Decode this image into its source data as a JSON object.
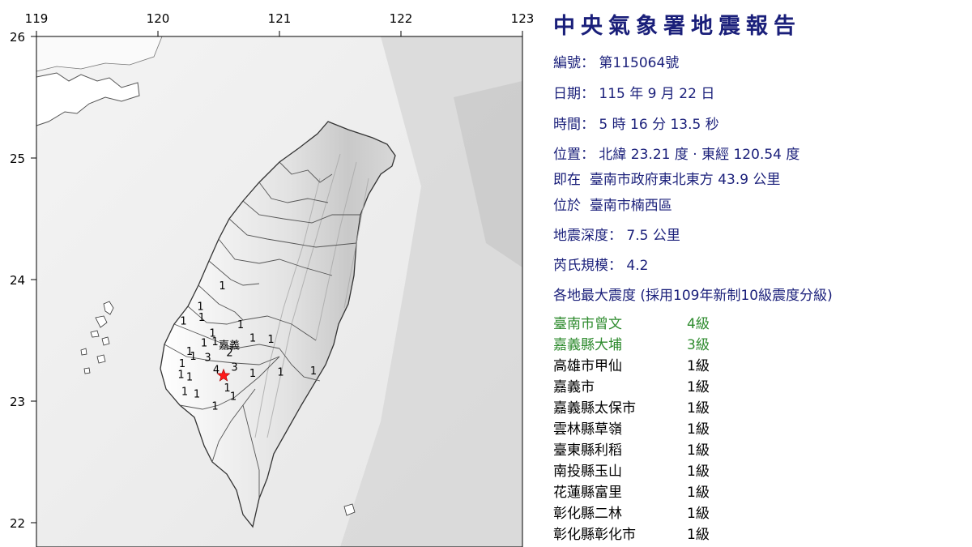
{
  "map": {
    "lon_ticks": [
      "119",
      "120",
      "121",
      "122",
      "123"
    ],
    "lat_ticks": [
      "26",
      "25",
      "24",
      "23",
      "22"
    ],
    "epicenter": {
      "lon": 120.54,
      "lat": 23.21,
      "color": "#ff1a1a"
    },
    "place_label": "嘉義",
    "intensity_markers": [
      {
        "v": "1",
        "lon": 120.53,
        "lat": 23.92
      },
      {
        "v": "1",
        "lon": 120.35,
        "lat": 23.75
      },
      {
        "v": "1",
        "lon": 120.21,
        "lat": 23.63
      },
      {
        "v": "1",
        "lon": 120.36,
        "lat": 23.66
      },
      {
        "v": "1",
        "lon": 120.68,
        "lat": 23.6
      },
      {
        "v": "1",
        "lon": 120.45,
        "lat": 23.53
      },
      {
        "v": "1",
        "lon": 120.38,
        "lat": 23.45
      },
      {
        "v": "1",
        "lon": 120.47,
        "lat": 23.46
      },
      {
        "v": "1",
        "lon": 120.78,
        "lat": 23.49
      },
      {
        "v": "1",
        "lon": 120.93,
        "lat": 23.48
      },
      {
        "v": "1",
        "lon": 120.26,
        "lat": 23.38
      },
      {
        "v": "1",
        "lon": 120.2,
        "lat": 23.28
      },
      {
        "v": "1",
        "lon": 120.29,
        "lat": 23.34
      },
      {
        "v": "1",
        "lon": 120.19,
        "lat": 23.19
      },
      {
        "v": "1",
        "lon": 120.26,
        "lat": 23.17
      },
      {
        "v": "1",
        "lon": 120.22,
        "lat": 23.05
      },
      {
        "v": "1",
        "lon": 120.32,
        "lat": 23.03
      },
      {
        "v": "1",
        "lon": 120.57,
        "lat": 23.08
      },
      {
        "v": "1",
        "lon": 120.62,
        "lat": 23.01
      },
      {
        "v": "1",
        "lon": 120.47,
        "lat": 22.93
      },
      {
        "v": "1",
        "lon": 120.78,
        "lat": 23.2
      },
      {
        "v": "1",
        "lon": 121.01,
        "lat": 23.21
      },
      {
        "v": "1",
        "lon": 121.28,
        "lat": 23.22
      },
      {
        "v": "2",
        "lon": 120.59,
        "lat": 23.37,
        "color": "#2a2ad6"
      },
      {
        "v": "3",
        "lon": 120.41,
        "lat": 23.33,
        "color": "#2e8b2e"
      },
      {
        "v": "4",
        "lon": 120.48,
        "lat": 23.23,
        "color": "#2e8b2e"
      },
      {
        "v": "3",
        "lon": 120.63,
        "lat": 23.25,
        "color": "#2e8b2e"
      }
    ]
  },
  "report": {
    "title": "中央氣象署地震報告",
    "number_label": "編號：",
    "number_value": "第115064號",
    "date_label": "日期：",
    "date_value": "115 年 9 月 22 日",
    "time_label": "時間：",
    "time_value": "5 時 16 分 13.5 秒",
    "location_label": "位置：",
    "location_value": "北緯 23.21 度 · 東經 120.54 度",
    "relative_label": "即在",
    "relative_value": "臺南市政府東北東方 43.9 公里",
    "district_label": "位於",
    "district_value": "臺南市楠西區",
    "depth_label": "地震深度：",
    "depth_value": "7.5 公里",
    "magnitude_label": "芮氏規模：",
    "magnitude_value": "4.2",
    "intensity_heading": "各地最大震度 (採用109年新制10級震度分級)",
    "stations": [
      {
        "name": "臺南市曾文",
        "level": "4級",
        "color": "#2e8b2e"
      },
      {
        "name": "嘉義縣大埔",
        "level": "3級",
        "color": "#2e8b2e"
      },
      {
        "name": "高雄市甲仙",
        "level": "1級",
        "color": "#000000"
      },
      {
        "name": "嘉義市",
        "level": "1級",
        "color": "#000000"
      },
      {
        "name": "嘉義縣太保市",
        "level": "1級",
        "color": "#000000"
      },
      {
        "name": "雲林縣草嶺",
        "level": "1級",
        "color": "#000000"
      },
      {
        "name": "臺東縣利稻",
        "level": "1級",
        "color": "#000000"
      },
      {
        "name": "南投縣玉山",
        "level": "1級",
        "color": "#000000"
      },
      {
        "name": "花蓮縣富里",
        "level": "1級",
        "color": "#000000"
      },
      {
        "name": "彰化縣二林",
        "level": "1級",
        "color": "#000000"
      },
      {
        "name": "彰化縣彰化市",
        "level": "1級",
        "color": "#000000"
      }
    ]
  }
}
